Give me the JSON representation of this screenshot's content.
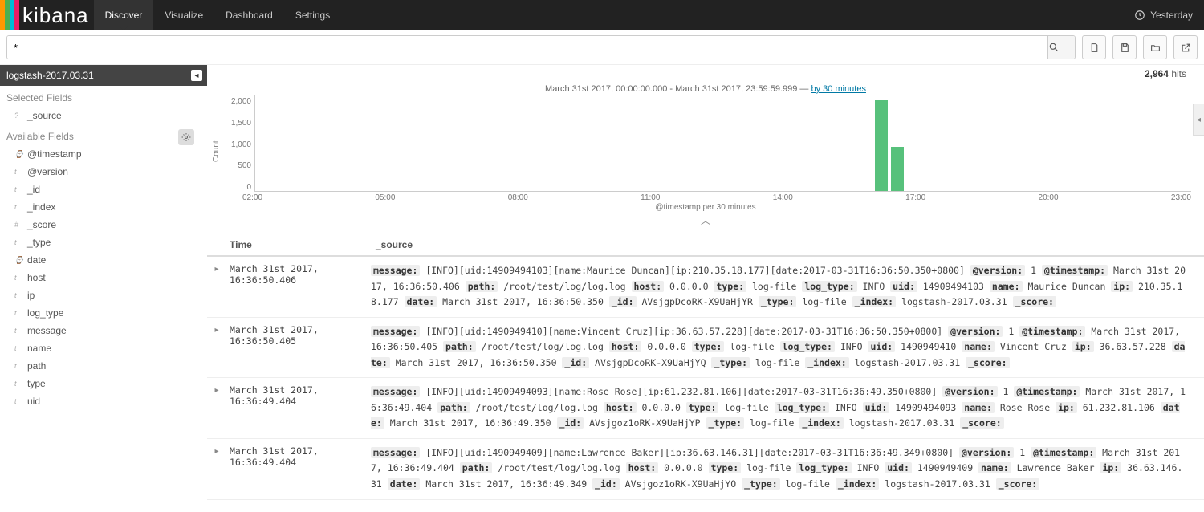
{
  "nav": {
    "tabs": [
      "Discover",
      "Visualize",
      "Dashboard",
      "Settings"
    ],
    "active": 0,
    "timepicker": "Yesterday"
  },
  "search": {
    "query": "*"
  },
  "index": {
    "pattern": "logstash-2017.03.31"
  },
  "hits": {
    "count": "2,964",
    "label": "hits"
  },
  "sidebar": {
    "selected_title": "Selected Fields",
    "selected": [
      {
        "type": "?",
        "name": "_source"
      }
    ],
    "available_title": "Available Fields",
    "available": [
      {
        "type": "⌚",
        "name": "@timestamp"
      },
      {
        "type": "t",
        "name": "@version"
      },
      {
        "type": "t",
        "name": "_id"
      },
      {
        "type": "t",
        "name": "_index"
      },
      {
        "type": "#",
        "name": "_score"
      },
      {
        "type": "t",
        "name": "_type"
      },
      {
        "type": "⌚",
        "name": "date"
      },
      {
        "type": "t",
        "name": "host"
      },
      {
        "type": "t",
        "name": "ip"
      },
      {
        "type": "t",
        "name": "log_type"
      },
      {
        "type": "t",
        "name": "message"
      },
      {
        "type": "t",
        "name": "name"
      },
      {
        "type": "t",
        "name": "path"
      },
      {
        "type": "t",
        "name": "type"
      },
      {
        "type": "t",
        "name": "uid"
      }
    ]
  },
  "chart_data": {
    "type": "bar",
    "title": "March 31st 2017, 00:00:00.000 - March 31st 2017, 23:59:59.999 — ",
    "interval_link": "by 30 minutes",
    "xlabel": "@timestamp per 30 minutes",
    "ylabel": "Count",
    "ylim": [
      0,
      2000
    ],
    "yticks": [
      "2,000",
      "1,500",
      "1,000",
      "500",
      "0"
    ],
    "xticks": [
      "02:00",
      "05:00",
      "08:00",
      "11:00",
      "14:00",
      "17:00",
      "20:00",
      "23:00"
    ],
    "series": [
      {
        "name": "count",
        "points": [
          {
            "x": "16:00",
            "value": 2000,
            "left_pct": 66.2,
            "height_pct": 96
          },
          {
            "x": "16:30",
            "value": 960,
            "left_pct": 67.9,
            "height_pct": 46
          }
        ]
      }
    ]
  },
  "table": {
    "columns": {
      "time": "Time",
      "source": "_source"
    },
    "rows": [
      {
        "time": "March 31st 2017, 16:36:50.406",
        "fields": [
          {
            "k": "message",
            "v": "[INFO][uid:14909494103][name:Maurice Duncan][ip:210.35.18.177][date:2017-03-31T16:36:50.350+0800]"
          },
          {
            "k": "@version",
            "v": "1"
          },
          {
            "k": "@timestamp",
            "v": "March 31st 2017, 16:36:50.406"
          },
          {
            "k": "path",
            "v": "/root/test/log/log.log"
          },
          {
            "k": "host",
            "v": "0.0.0.0"
          },
          {
            "k": "type",
            "v": "log-file"
          },
          {
            "k": "log_type",
            "v": "INFO"
          },
          {
            "k": "uid",
            "v": "14909494103"
          },
          {
            "k": "name",
            "v": "Maurice Duncan"
          },
          {
            "k": "ip",
            "v": "210.35.18.177"
          },
          {
            "k": "date",
            "v": "March 31st 2017, 16:36:50.350"
          },
          {
            "k": "_id",
            "v": "AVsjgpDcoRK-X9UaHjYR"
          },
          {
            "k": "_type",
            "v": "log-file"
          },
          {
            "k": "_index",
            "v": "logstash-2017.03.31"
          },
          {
            "k": "_score",
            "v": ""
          }
        ]
      },
      {
        "time": "March 31st 2017, 16:36:50.405",
        "fields": [
          {
            "k": "message",
            "v": "[INFO][uid:1490949410][name:Vincent Cruz][ip:36.63.57.228][date:2017-03-31T16:36:50.350+0800]"
          },
          {
            "k": "@version",
            "v": "1"
          },
          {
            "k": "@timestamp",
            "v": "March 31st 2017, 16:36:50.405"
          },
          {
            "k": "path",
            "v": "/root/test/log/log.log"
          },
          {
            "k": "host",
            "v": "0.0.0.0"
          },
          {
            "k": "type",
            "v": "log-file"
          },
          {
            "k": "log_type",
            "v": "INFO"
          },
          {
            "k": "uid",
            "v": "1490949410"
          },
          {
            "k": "name",
            "v": "Vincent Cruz"
          },
          {
            "k": "ip",
            "v": "36.63.57.228"
          },
          {
            "k": "date",
            "v": "March 31st 2017, 16:36:50.350"
          },
          {
            "k": "_id",
            "v": "AVsjgpDcoRK-X9UaHjYQ"
          },
          {
            "k": "_type",
            "v": "log-file"
          },
          {
            "k": "_index",
            "v": "logstash-2017.03.31"
          },
          {
            "k": "_score",
            "v": ""
          }
        ]
      },
      {
        "time": "March 31st 2017, 16:36:49.404",
        "fields": [
          {
            "k": "message",
            "v": "[INFO][uid:14909494093][name:Rose Rose][ip:61.232.81.106][date:2017-03-31T16:36:49.350+0800]"
          },
          {
            "k": "@version",
            "v": "1"
          },
          {
            "k": "@timestamp",
            "v": "March 31st 2017, 16:36:49.404"
          },
          {
            "k": "path",
            "v": "/root/test/log/log.log"
          },
          {
            "k": "host",
            "v": "0.0.0.0"
          },
          {
            "k": "type",
            "v": "log-file"
          },
          {
            "k": "log_type",
            "v": "INFO"
          },
          {
            "k": "uid",
            "v": "14909494093"
          },
          {
            "k": "name",
            "v": "Rose Rose"
          },
          {
            "k": "ip",
            "v": "61.232.81.106"
          },
          {
            "k": "date",
            "v": "March 31st 2017, 16:36:49.350"
          },
          {
            "k": "_id",
            "v": "AVsjgoz1oRK-X9UaHjYP"
          },
          {
            "k": "_type",
            "v": "log-file"
          },
          {
            "k": "_index",
            "v": "logstash-2017.03.31"
          },
          {
            "k": "_score",
            "v": ""
          }
        ]
      },
      {
        "time": "March 31st 2017, 16:36:49.404",
        "fields": [
          {
            "k": "message",
            "v": "[INFO][uid:1490949409][name:Lawrence Baker][ip:36.63.146.31][date:2017-03-31T16:36:49.349+0800]"
          },
          {
            "k": "@version",
            "v": "1"
          },
          {
            "k": "@timestamp",
            "v": "March 31st 2017, 16:36:49.404"
          },
          {
            "k": "path",
            "v": "/root/test/log/log.log"
          },
          {
            "k": "host",
            "v": "0.0.0.0"
          },
          {
            "k": "type",
            "v": "log-file"
          },
          {
            "k": "log_type",
            "v": "INFO"
          },
          {
            "k": "uid",
            "v": "1490949409"
          },
          {
            "k": "name",
            "v": "Lawrence Baker"
          },
          {
            "k": "ip",
            "v": "36.63.146.31"
          },
          {
            "k": "date",
            "v": "March 31st 2017, 16:36:49.349"
          },
          {
            "k": "_id",
            "v": "AVsjgoz1oRK-X9UaHjYO"
          },
          {
            "k": "_type",
            "v": "log-file"
          },
          {
            "k": "_index",
            "v": "logstash-2017.03.31"
          },
          {
            "k": "_score",
            "v": ""
          }
        ]
      }
    ]
  }
}
